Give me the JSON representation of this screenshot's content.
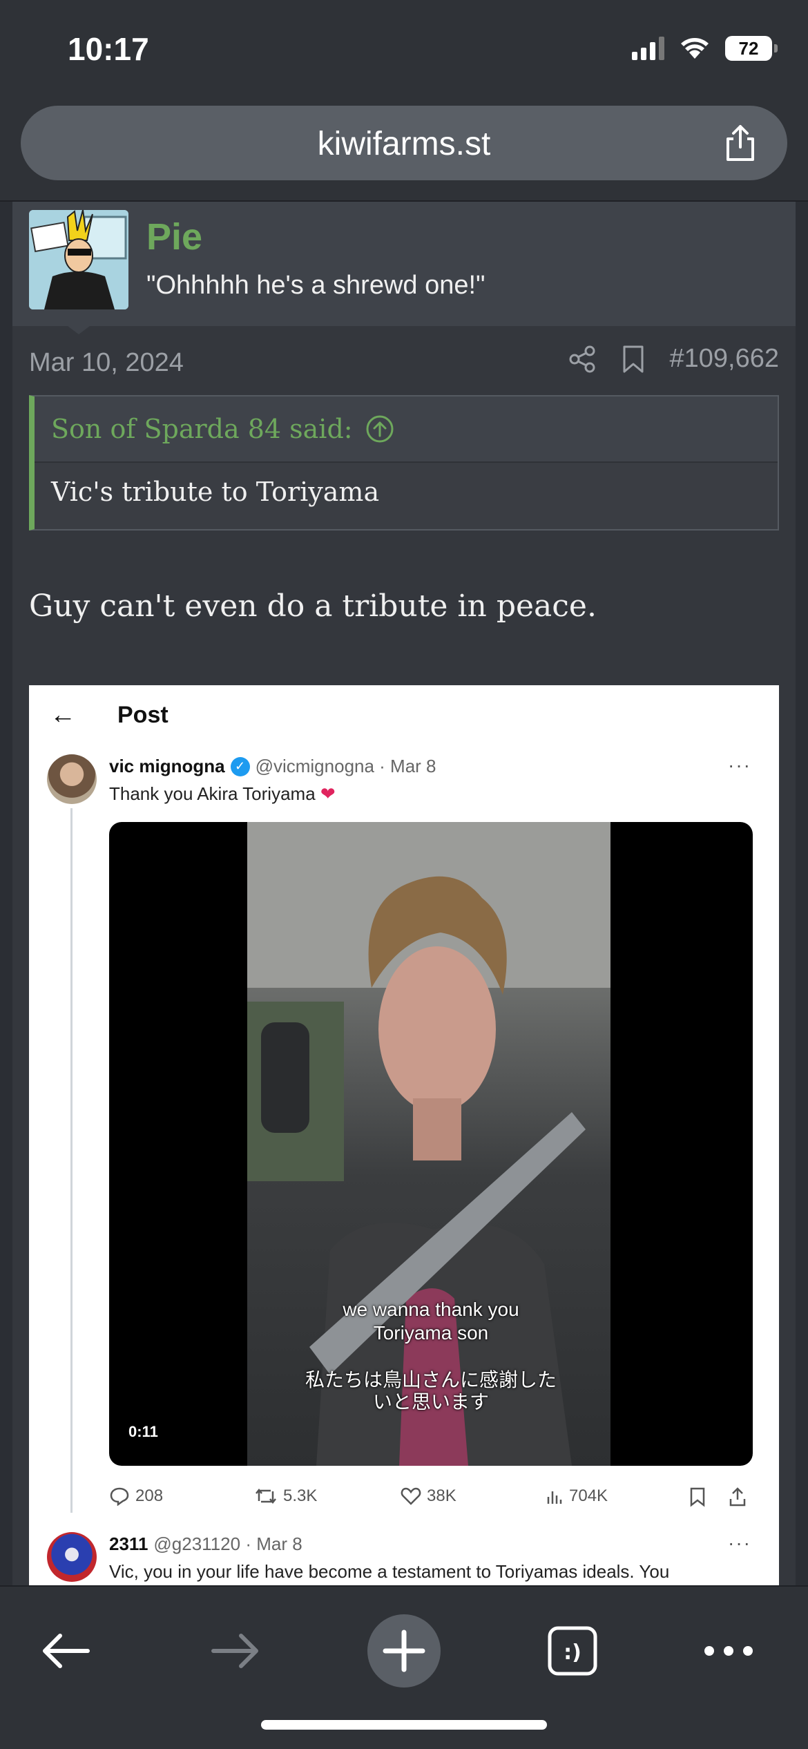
{
  "status_bar": {
    "time": "10:17",
    "battery": "72"
  },
  "browser": {
    "url": "kiwifarms.st"
  },
  "post": {
    "username": "Pie",
    "user_title": "\"Ohhhhh he's a shrewd one!\"",
    "date": "Mar 10, 2024",
    "post_number": "#109,662",
    "quote": {
      "author_line": "Son of Sparda 84 said:",
      "text": "Vic's tribute to Toriyama"
    },
    "body": "Guy can't even do a tribute in peace."
  },
  "tweet": {
    "nav_title": "Post",
    "main": {
      "name": "vic mignogna",
      "handle_date": "@vicmignogna · Mar 8",
      "text": "Thank you Akira Toriyama",
      "emoji": "❤",
      "video": {
        "caption_en_line1": "we wanna thank you",
        "caption_en_line2": "Toriyama son",
        "caption_jp_line1": "私たちは鳥山さんに感謝した",
        "caption_jp_line2": "いと思います",
        "duration": "0:11"
      },
      "stats": {
        "replies": "208",
        "reposts": "5.3K",
        "likes": "38K",
        "views": "704K"
      }
    },
    "reply": {
      "name": "2311",
      "handle_date": "@g231120 · Mar 8",
      "text": "Vic, you in your life have become a testament to Toriyamas ideals. You"
    }
  },
  "colors": {
    "accent_green": "#6ea85c",
    "background": "#2b2e34",
    "twitter_blue": "#1d9bf0"
  }
}
